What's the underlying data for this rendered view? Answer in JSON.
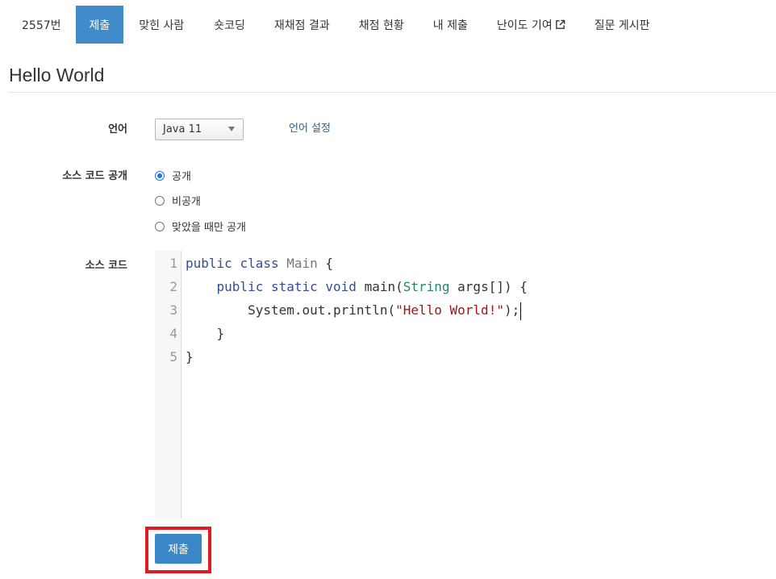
{
  "nav": {
    "tabs": [
      {
        "label": "2557번",
        "active": false
      },
      {
        "label": "제출",
        "active": true
      },
      {
        "label": "맞힌 사람",
        "active": false
      },
      {
        "label": "숏코딩",
        "active": false
      },
      {
        "label": "재채점 결과",
        "active": false
      },
      {
        "label": "채점 현황",
        "active": false
      },
      {
        "label": "내 제출",
        "active": false
      },
      {
        "label": "난이도 기여",
        "active": false,
        "icon": "external-link-icon"
      },
      {
        "label": "질문 게시판",
        "active": false
      }
    ],
    "active_color": "#428bca"
  },
  "problem": {
    "title": "Hello World"
  },
  "form": {
    "language_label": "언어",
    "language_value": "Java 11",
    "language_settings_link": "언어 설정",
    "visibility_label": "소스 코드 공개",
    "visibility_options": [
      {
        "label": "공개",
        "checked": true
      },
      {
        "label": "비공개",
        "checked": false
      },
      {
        "label": "맞았을 때만 공개",
        "checked": false
      }
    ],
    "source_label": "소스 코드",
    "submit_label": "제출"
  },
  "editor": {
    "line_numbers": [
      "1",
      "2",
      "3",
      "4",
      "5"
    ],
    "lines": [
      [
        "public",
        " ",
        "class",
        " ",
        "Main",
        " {"
      ],
      [
        "    ",
        "public",
        " ",
        "static",
        " ",
        "void",
        " main(",
        "String",
        " args[]) {"
      ],
      [
        "        System.out.println(",
        "\"Hello World!\"",
        ");"
      ],
      [
        "    }"
      ],
      [
        "}"
      ]
    ]
  },
  "colors": {
    "highlight_frame": "#e01b24",
    "submit_button": "#3a87c8",
    "keyword": "#334d99",
    "type": "#1d8a6a",
    "string": "#a31515"
  }
}
